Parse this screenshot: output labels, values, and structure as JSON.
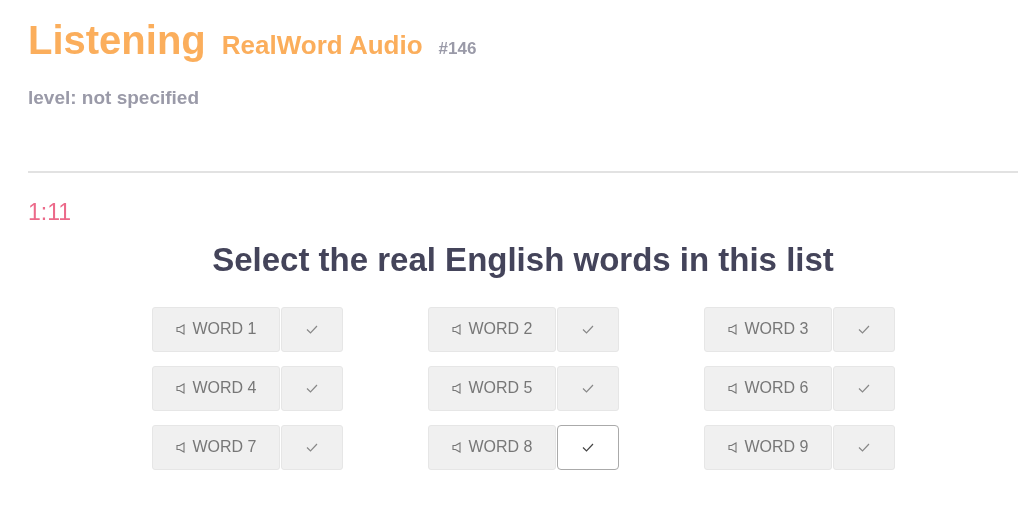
{
  "header": {
    "title": "Listening",
    "subtitle": "RealWord Audio",
    "number": "#146",
    "level": "level: not specified"
  },
  "timer": "1:11",
  "question": "Select the real English words in this list",
  "words": [
    {
      "label": "WORD 1",
      "selected": false
    },
    {
      "label": "WORD 2",
      "selected": false
    },
    {
      "label": "WORD 3",
      "selected": false
    },
    {
      "label": "WORD 4",
      "selected": false
    },
    {
      "label": "WORD 5",
      "selected": false
    },
    {
      "label": "WORD 6",
      "selected": false
    },
    {
      "label": "WORD 7",
      "selected": false
    },
    {
      "label": "WORD 8",
      "selected": true
    },
    {
      "label": "WORD 9",
      "selected": false
    }
  ]
}
